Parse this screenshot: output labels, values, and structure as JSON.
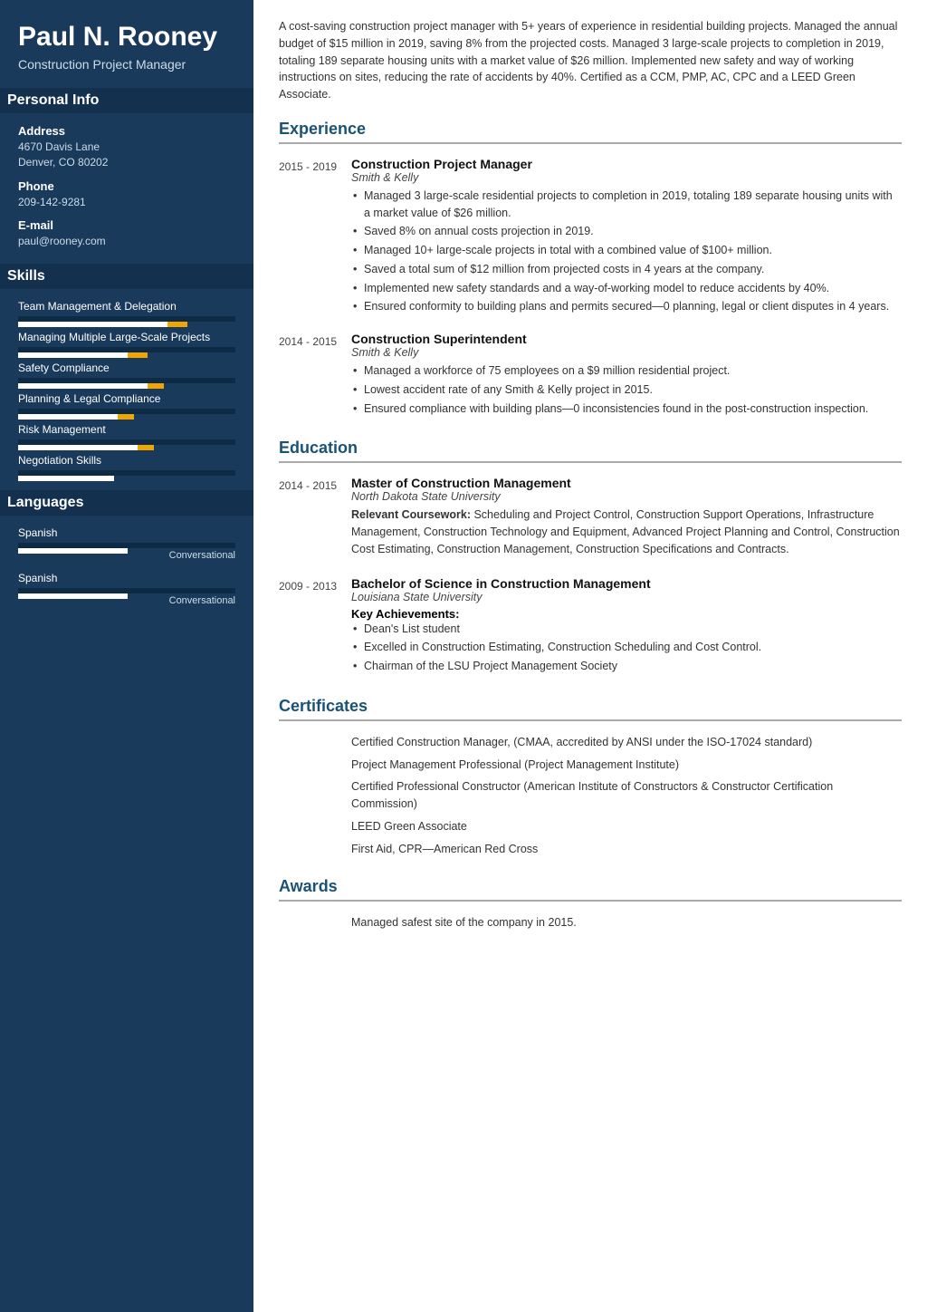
{
  "sidebar": {
    "name": "Paul N. Rooney",
    "job_title": "Construction Project Manager",
    "sections": {
      "personal_info_title": "Personal Info",
      "address_label": "Address",
      "address_value": "4670 Davis Lane\nDenver, CO 80202",
      "phone_label": "Phone",
      "phone_value": "209-142-9281",
      "email_label": "E-mail",
      "email_value": "paul@rooney.com",
      "skills_title": "Skills",
      "skills": [
        {
          "name": "Team Management & Delegation",
          "fill_pct": 75,
          "extra_pct": 10
        },
        {
          "name": "Managing Multiple Large-Scale Projects",
          "fill_pct": 55,
          "extra_pct": 10
        },
        {
          "name": "Safety Compliance",
          "fill_pct": 65,
          "extra_pct": 8
        },
        {
          "name": "Planning & Legal Compliance",
          "fill_pct": 50,
          "extra_pct": 8
        },
        {
          "name": "Risk Management",
          "fill_pct": 60,
          "extra_pct": 8
        },
        {
          "name": "Negotiation Skills",
          "fill_pct": 48,
          "extra_pct": 0
        }
      ],
      "languages_title": "Languages",
      "languages": [
        {
          "name": "Spanish",
          "fill_pct": 55,
          "level": "Conversational"
        },
        {
          "name": "Spanish",
          "fill_pct": 55,
          "level": "Conversational"
        }
      ]
    }
  },
  "main": {
    "summary": "A cost-saving construction project manager with 5+ years of experience in residential building projects. Managed the annual budget of $15 million in 2019, saving 8% from the projected costs. Managed 3 large-scale projects to completion in 2019, totaling 189 separate housing units with a market value of $26 million. Implemented new safety and way of working instructions on sites, reducing the rate of accidents by 40%. Certified as a CCM, PMP, AC, CPC and a LEED Green Associate.",
    "experience_title": "Experience",
    "experience": [
      {
        "dates": "2015 - 2019",
        "job_title": "Construction Project Manager",
        "company": "Smith & Kelly",
        "bullets": [
          "Managed 3 large-scale residential projects to completion in 2019, totaling 189 separate housing units with a market value of $26 million.",
          "Saved 8% on annual costs projection in 2019.",
          "Managed 10+ large-scale projects in total with a combined value of $100+ million.",
          "Saved a total sum of $12 million from projected costs in 4 years at the company.",
          "Implemented new safety standards and a way-of-working model to reduce accidents by 40%.",
          "Ensured conformity to building plans and permits secured—0 planning, legal or client disputes in 4 years."
        ]
      },
      {
        "dates": "2014 - 2015",
        "job_title": "Construction Superintendent",
        "company": "Smith & Kelly",
        "bullets": [
          "Managed a workforce of 75 employees on a $9 million residential project.",
          "Lowest accident rate of any Smith & Kelly project in 2015.",
          "Ensured compliance with building plans—0 inconsistencies found in the post-construction inspection."
        ]
      }
    ],
    "education_title": "Education",
    "education": [
      {
        "dates": "2014 - 2015",
        "degree": "Master of Construction Management",
        "school": "North Dakota State University",
        "coursework_label": "Relevant Coursework:",
        "coursework": "Scheduling and Project Control, Construction Support Operations, Infrastructure Management, Construction Technology and Equipment, Advanced Project Planning and Control, Construction Cost Estimating, Construction Management, Construction Specifications and Contracts.",
        "achievements_label": "",
        "bullets": []
      },
      {
        "dates": "2009 - 2013",
        "degree": "Bachelor of Science in Construction Management",
        "school": "Louisiana State University",
        "coursework_label": "",
        "coursework": "",
        "achievements_label": "Key Achievements:",
        "bullets": [
          "Dean's List student",
          "Excelled in Construction Estimating, Construction Scheduling and Cost Control.",
          "Chairman of the LSU Project Management Society"
        ]
      }
    ],
    "certificates_title": "Certificates",
    "certificates": [
      "Certified Construction Manager, (CMAA, accredited by ANSI under the ISO-17024 standard)",
      "Project Management Professional (Project Management Institute)",
      "Certified Professional Constructor (American Institute of Constructors & Constructor Certification Commission)",
      "LEED Green Associate",
      "First Aid, CPR—American Red Cross"
    ],
    "awards_title": "Awards",
    "awards": [
      "Managed safest site of the company in 2015."
    ]
  }
}
